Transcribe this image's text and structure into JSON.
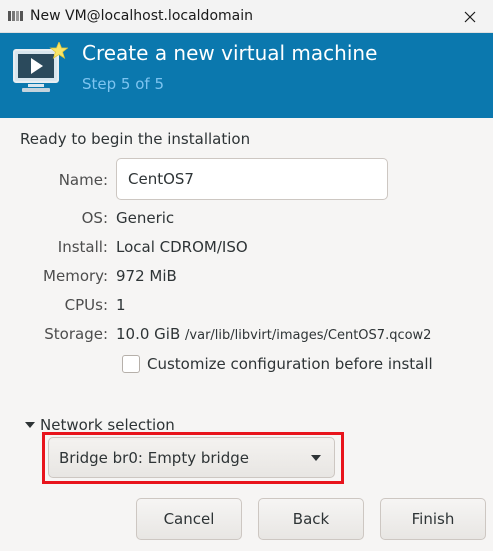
{
  "window": {
    "title": "New VM@localhost.localdomain",
    "app_icon": "virt-manager-icon",
    "close_icon": "close-icon"
  },
  "header": {
    "title": "Create a new virtual machine",
    "step": "Step 5 of 5",
    "icon": "monitor-play-icon",
    "background_color": "#0b78ae"
  },
  "summary": {
    "heading": "Ready to begin the installation",
    "name_label": "Name:",
    "name_value": "CentOS7",
    "os_label": "OS:",
    "os_value": "Generic",
    "install_label": "Install:",
    "install_value": "Local CDROM/ISO",
    "memory_label": "Memory:",
    "memory_value": "972 MiB",
    "cpus_label": "CPUs:",
    "cpus_value": "1",
    "storage_label": "Storage:",
    "storage_size": "10.0 GiB",
    "storage_path": "/var/lib/libvirt/images/CentOS7.qcow2"
  },
  "customize": {
    "label": "Customize configuration before install",
    "checked": false
  },
  "network": {
    "expander_label": "Network selection",
    "expanded": true,
    "selected": "Bridge br0: Empty bridge",
    "highlight_color": "#e8141c"
  },
  "buttons": {
    "cancel": "Cancel",
    "back": "Back",
    "finish": "Finish"
  }
}
